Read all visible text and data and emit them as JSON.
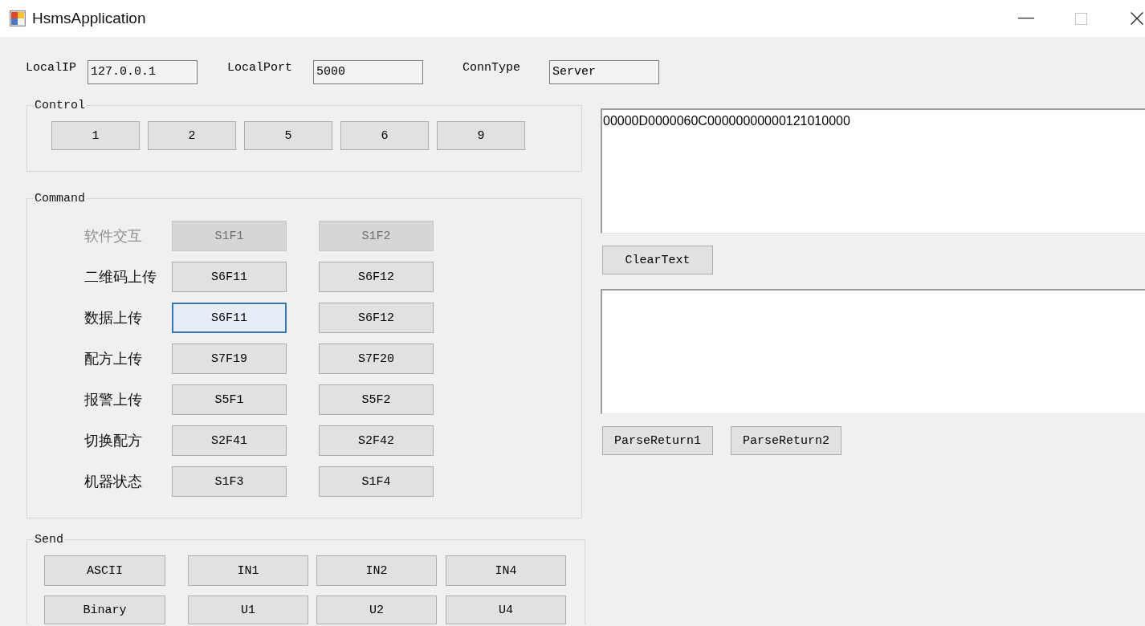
{
  "window": {
    "title": "HsmsApplication",
    "maximize_disabled": true
  },
  "connection": {
    "fields": [
      {
        "label": "LocalIP",
        "value": "127.0.0.1"
      },
      {
        "label": "LocalPort",
        "value": "5000"
      },
      {
        "label": "ConnType",
        "value": "Server"
      }
    ]
  },
  "control_group": {
    "title": "Control",
    "buttons": [
      "1",
      "2",
      "5",
      "6",
      "9"
    ]
  },
  "command_group": {
    "title": "Command",
    "rows": [
      {
        "label": "软件交互",
        "disabled": true,
        "buttons": [
          {
            "label": "S1F1",
            "focused": false
          },
          {
            "label": "S1F2",
            "focused": false
          }
        ]
      },
      {
        "label": "二维码上传",
        "disabled": false,
        "buttons": [
          {
            "label": "S6F11",
            "focused": false
          },
          {
            "label": "S6F12",
            "focused": false
          }
        ]
      },
      {
        "label": "数据上传",
        "disabled": false,
        "buttons": [
          {
            "label": "S6F11",
            "focused": true
          },
          {
            "label": "S6F12",
            "focused": false
          }
        ]
      },
      {
        "label": "配方上传",
        "disabled": false,
        "buttons": [
          {
            "label": "S7F19",
            "focused": false
          },
          {
            "label": "S7F20",
            "focused": false
          }
        ]
      },
      {
        "label": "报警上传",
        "disabled": false,
        "buttons": [
          {
            "label": "S5F1",
            "focused": false
          },
          {
            "label": "S5F2",
            "focused": false
          }
        ]
      },
      {
        "label": "切换配方",
        "disabled": false,
        "buttons": [
          {
            "label": "S2F41",
            "focused": false
          },
          {
            "label": "S2F42",
            "focused": false
          }
        ]
      },
      {
        "label": "机器状态",
        "disabled": false,
        "buttons": [
          {
            "label": "S1F3",
            "focused": false
          },
          {
            "label": "S1F4",
            "focused": false
          }
        ]
      }
    ]
  },
  "send_group": {
    "title": "Send",
    "rows": [
      {
        "format": "ASCII",
        "types": [
          "IN1",
          "IN2",
          "IN4"
        ]
      },
      {
        "format": "Binary",
        "types": [
          "U1",
          "U2",
          "U4"
        ]
      }
    ]
  },
  "output": {
    "message_text": "00000D0000060C00000000000121010000",
    "clear_button": "ClearText",
    "parse_buttons": [
      "ParseReturn1",
      "ParseReturn2"
    ]
  }
}
